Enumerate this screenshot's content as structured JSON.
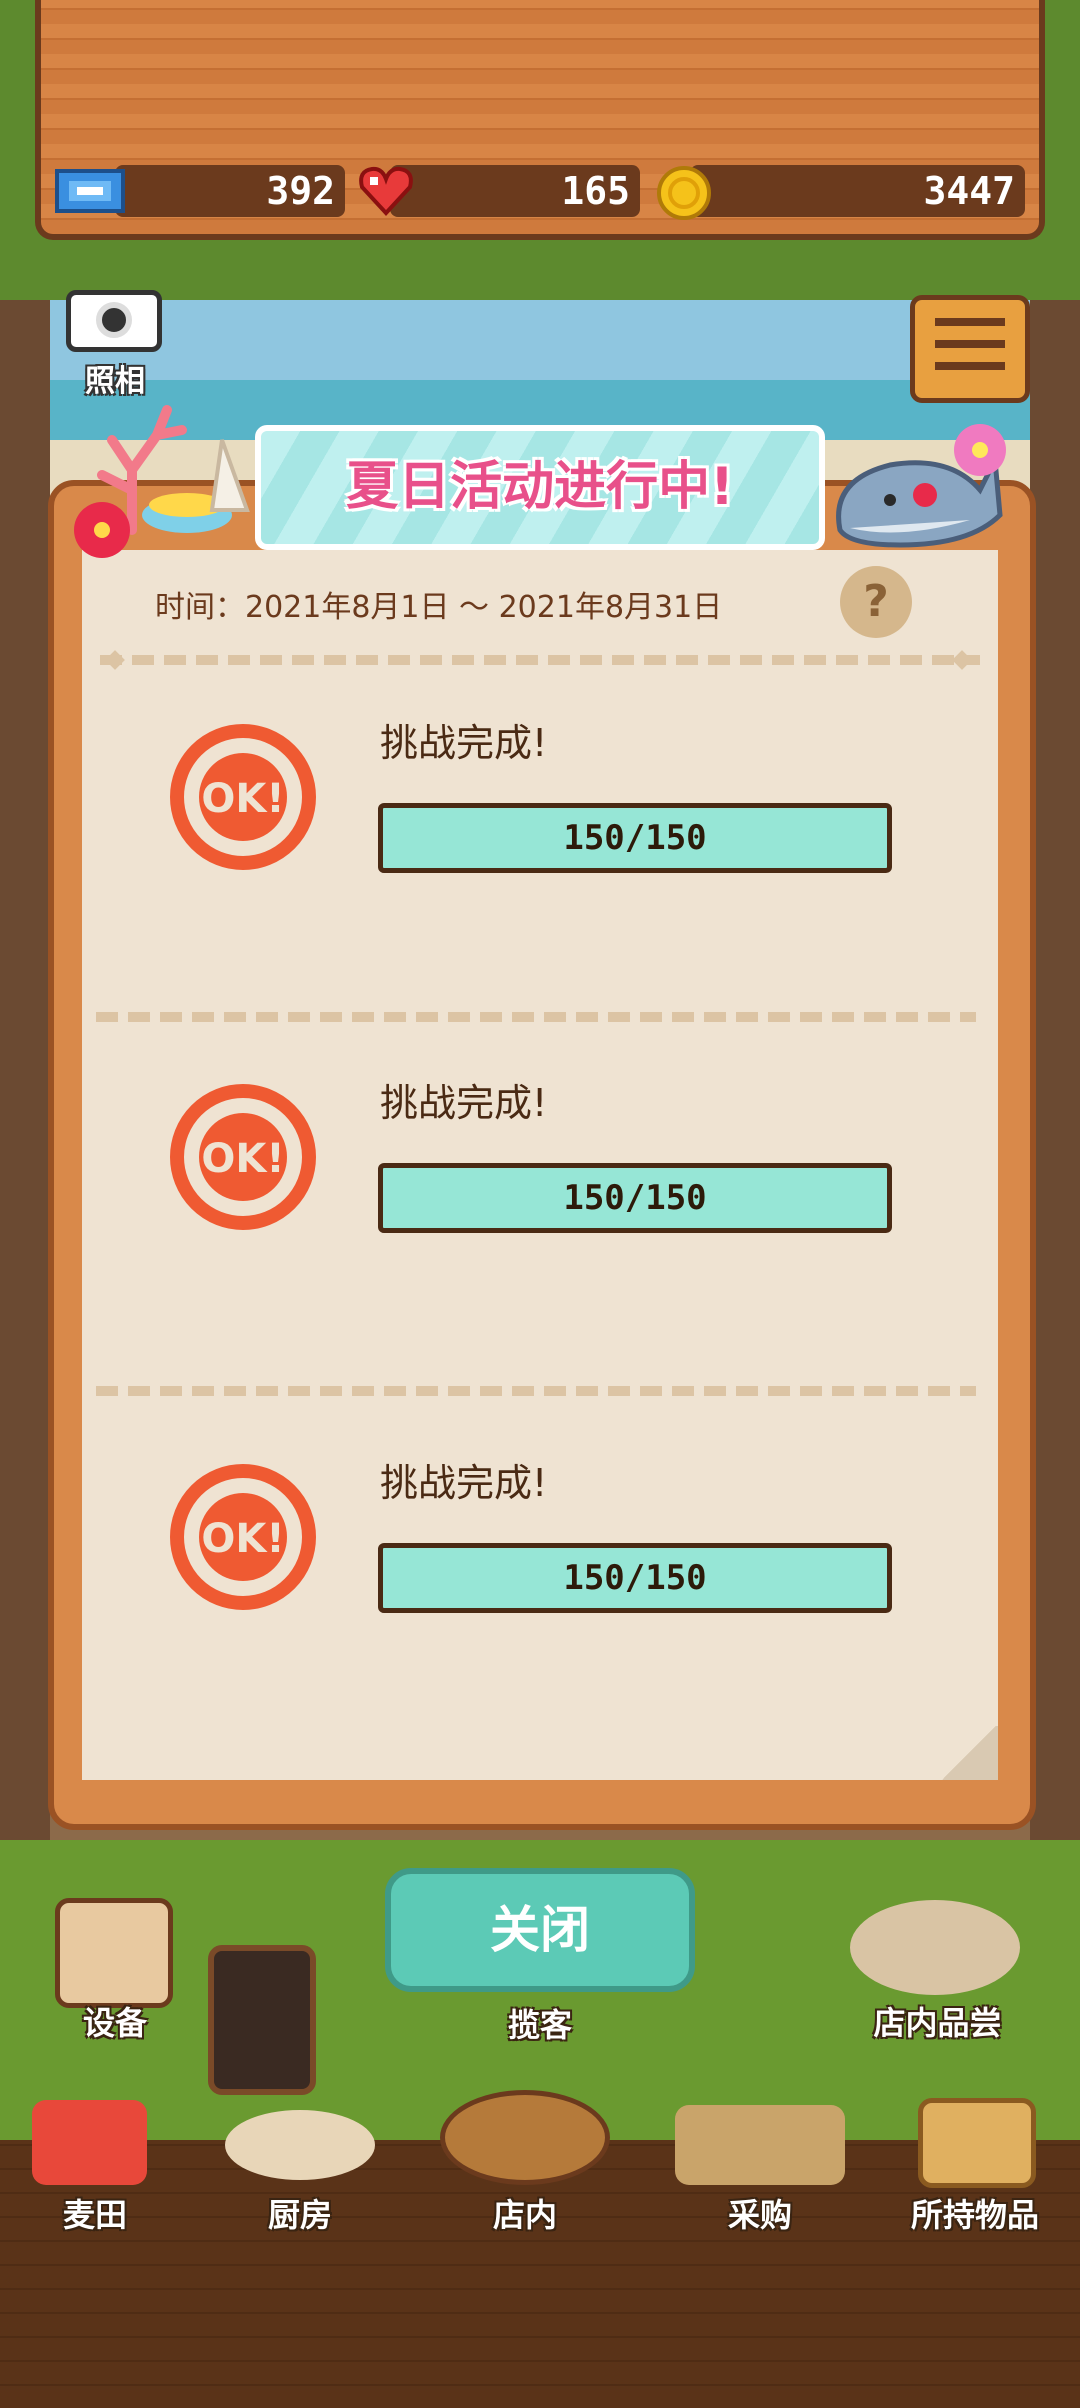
{
  "stats": {
    "tickets": "392",
    "hearts": "165",
    "coins": "3447"
  },
  "scene": {
    "camera_label": "照相"
  },
  "event": {
    "title": "夏日活动进行中!",
    "time_text": "时间：2021年8月1日 ～ 2021年8月31日",
    "help_label": "?",
    "challenges": [
      {
        "status": "挑战完成!",
        "progress": "150/150",
        "stamp": "OK!"
      },
      {
        "status": "挑战完成!",
        "progress": "150/150",
        "stamp": "OK!"
      },
      {
        "status": "挑战完成!",
        "progress": "150/150",
        "stamp": "OK!"
      }
    ],
    "close_label": "关闭"
  },
  "nav": {
    "equipment": "设备",
    "customers": "揽客",
    "tasting": "店内品尝",
    "wheat_field": "麦田",
    "kitchen": "厨房",
    "shop": "店内",
    "purchase": "采购",
    "inventory": "所持物品"
  },
  "colors": {
    "accent_mint": "#96e6d6",
    "close_button": "#5ccab6",
    "stamp_red": "#ef5a32",
    "banner_pink": "#e8508a"
  },
  "icons": [
    "ticket-icon",
    "heart-icon",
    "coin-icon",
    "camera-icon",
    "menu-icon",
    "help-icon",
    "ok-stamp-icon"
  ]
}
